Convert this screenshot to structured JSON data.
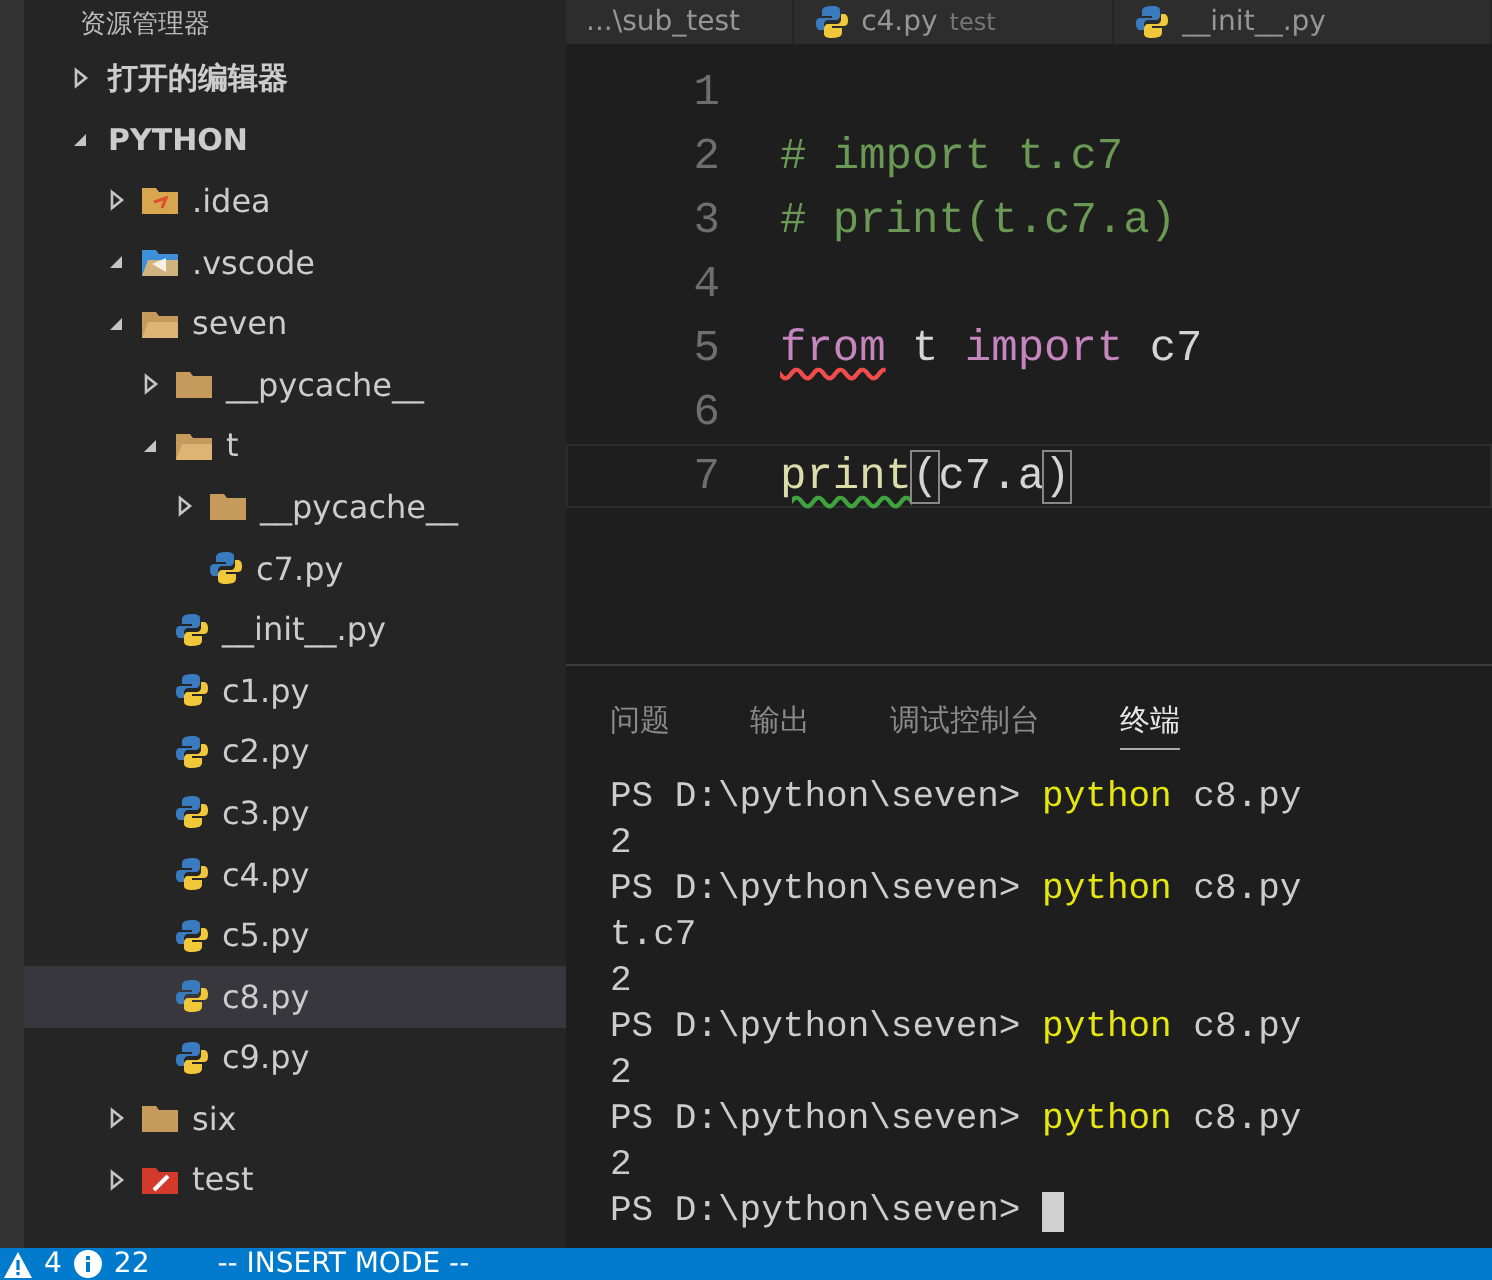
{
  "sidebar": {
    "title": "资源管理器",
    "sections": [
      {
        "label": "打开的编辑器",
        "expanded": false
      },
      {
        "label": "PYTHON",
        "expanded": true
      }
    ],
    "tree": [
      {
        "name": ".idea",
        "kind": "idea",
        "expanded": false,
        "selected": false
      },
      {
        "name": ".vscode",
        "kind": "vscode",
        "expanded": true,
        "selected": false
      },
      {
        "name": "seven",
        "kind": "folder",
        "expanded": true,
        "selected": false,
        "children": [
          {
            "name": "__pycache__",
            "kind": "folder",
            "expanded": false,
            "selected": false
          },
          {
            "name": "t",
            "kind": "folder",
            "expanded": true,
            "selected": false,
            "children": [
              {
                "name": "__pycache__",
                "kind": "folder",
                "expanded": false,
                "selected": false
              },
              {
                "name": "c7.py",
                "kind": "python",
                "selected": false
              }
            ]
          },
          {
            "name": "__init__.py",
            "kind": "python",
            "selected": false
          },
          {
            "name": "c1.py",
            "kind": "python",
            "selected": false
          },
          {
            "name": "c2.py",
            "kind": "python",
            "selected": false
          },
          {
            "name": "c3.py",
            "kind": "python",
            "selected": false
          },
          {
            "name": "c4.py",
            "kind": "python",
            "selected": false
          },
          {
            "name": "c5.py",
            "kind": "python",
            "selected": false
          },
          {
            "name": "c8.py",
            "kind": "python",
            "selected": true
          },
          {
            "name": "c9.py",
            "kind": "python",
            "selected": false
          }
        ]
      },
      {
        "name": "six",
        "kind": "folder",
        "expanded": false,
        "selected": false
      },
      {
        "name": "test",
        "kind": "test",
        "expanded": false,
        "selected": false
      }
    ]
  },
  "editor_tabs": [
    {
      "label": "...\\sub_test",
      "kind": "path",
      "selected": false
    },
    {
      "label": "c4.py",
      "description": "test",
      "kind": "python",
      "selected": false
    },
    {
      "label": "__init__.py",
      "kind": "python",
      "selected": false
    }
  ],
  "code": [
    {
      "number": "1",
      "current": false
    },
    {
      "number": "2",
      "current": false,
      "tokens": [
        {
          "text": "# import t.c7",
          "kind": "comment"
        }
      ]
    },
    {
      "number": "3",
      "current": false,
      "tokens": [
        {
          "text": "# print(t.c7.a)",
          "kind": "comment"
        }
      ]
    },
    {
      "number": "4",
      "current": false
    },
    {
      "number": "5",
      "current": false,
      "tokens": [
        {
          "text": "from",
          "kind": "keyword",
          "error": true
        },
        {
          "text": " t ",
          "kind": "plain"
        },
        {
          "text": "import",
          "kind": "keyword"
        },
        {
          "text": " c7",
          "kind": "plain"
        }
      ]
    },
    {
      "number": "6",
      "current": false
    },
    {
      "number": "7",
      "current": true,
      "tokens": [
        {
          "text": "print",
          "kind": "function",
          "warning": true
        },
        {
          "text": "(",
          "kind": "bracket"
        },
        {
          "text": "c7.a",
          "kind": "plain"
        },
        {
          "text": ")",
          "kind": "bracket"
        }
      ]
    }
  ],
  "panel_tabs": [
    {
      "label": "问题",
      "selected": false
    },
    {
      "label": "输出",
      "selected": false
    },
    {
      "label": "调试控制台",
      "selected": false
    },
    {
      "label": "终端",
      "selected": true
    }
  ],
  "terminal": [
    {
      "kind": "prompt",
      "prompt": "PS D:\\python\\seven>",
      "command": "python",
      "args": "c8.py"
    },
    {
      "kind": "output",
      "text": "2"
    },
    {
      "kind": "prompt",
      "prompt": "PS D:\\python\\seven>",
      "command": "python",
      "args": "c8.py"
    },
    {
      "kind": "output",
      "text": "t.c7"
    },
    {
      "kind": "output",
      "text": "2"
    },
    {
      "kind": "prompt",
      "prompt": "PS D:\\python\\seven>",
      "command": "python",
      "args": "c8.py"
    },
    {
      "kind": "output",
      "text": "2"
    },
    {
      "kind": "prompt",
      "prompt": "PS D:\\python\\seven>",
      "command": "python",
      "args": "c8.py"
    },
    {
      "kind": "output",
      "text": "2"
    },
    {
      "kind": "cursor",
      "prompt": "PS D:\\python\\seven>"
    }
  ],
  "status_bar": {
    "warnings": "4",
    "infos": "22",
    "mode": "-- INSERT MODE --"
  }
}
